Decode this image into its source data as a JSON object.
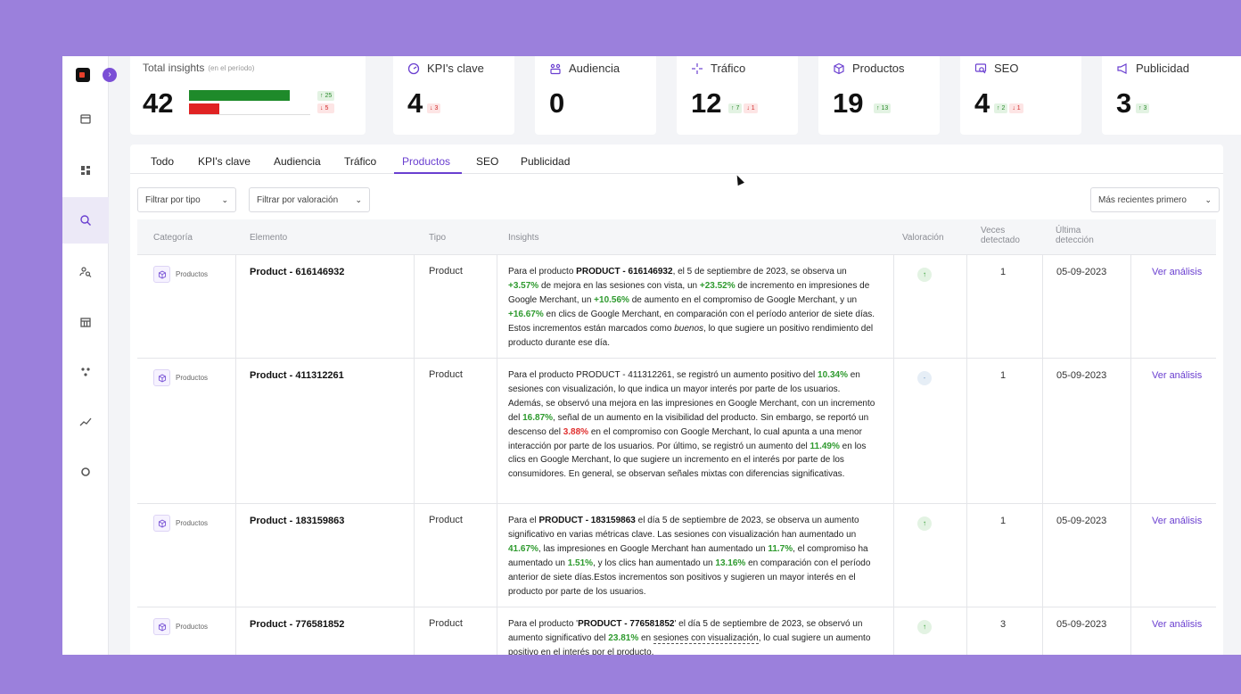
{
  "kpis": [
    {
      "title": "Total insights",
      "subtitle": "(en el período)",
      "value": "42",
      "up": "↑ 25",
      "down": "↓ 5",
      "up_fraction": 0.83,
      "down_fraction": 0.17
    },
    {
      "title": "KPI's clave",
      "value": "4",
      "down": "↓ 3",
      "icon": "gauge-icon"
    },
    {
      "title": "Audiencia",
      "value": "0",
      "icon": "audience-icon"
    },
    {
      "title": "Tráfico",
      "value": "12",
      "up": "↑ 7",
      "down": "↓ 1",
      "icon": "sparkle-icon"
    },
    {
      "title": "Productos",
      "value": "19",
      "up": "↑ 13",
      "icon": "box-icon"
    },
    {
      "title": "SEO",
      "value": "4",
      "up": "↑ 2",
      "down": "↓ 1",
      "icon": "seo-icon"
    },
    {
      "title": "Publicidad",
      "value": "3",
      "up": "↑ 3",
      "icon": "megaphone-icon"
    }
  ],
  "tabs": [
    "Todo",
    "KPI's clave",
    "Audiencia",
    "Tráfico",
    "Productos",
    "SEO",
    "Publicidad"
  ],
  "active_tab": "Productos",
  "filters": {
    "type": "Filtrar por tipo",
    "rating": "Filtrar por valoración",
    "sort": "Más recientes primero"
  },
  "columns": {
    "categoria": "Categoría",
    "elemento": "Elemento",
    "tipo": "Tipo",
    "insights": "Insights",
    "valoracion": "Valoración",
    "veces": "Veces detectado",
    "ultima": "Última detección"
  },
  "rows": [
    {
      "categoria": "Productos",
      "elemento": "Product - 616146932",
      "tipo": "Product",
      "rating": "↑",
      "veces": "1",
      "fecha": "05-09-2023",
      "link": "Ver análisis",
      "insight": [
        [
          "t",
          "Para el producto "
        ],
        [
          "b",
          "PRODUCT - 616146932"
        ],
        [
          "t",
          ", el 5 de septiembre de 2023, se observa un "
        ],
        [
          "g",
          "+3.57%"
        ],
        [
          "t",
          " de mejora en las sesiones con vista, un "
        ],
        [
          "g",
          "+23.52%"
        ],
        [
          "t",
          " de incremento en impresiones de Google Merchant, un "
        ],
        [
          "g",
          "+10.56%"
        ],
        [
          "t",
          " de aumento en el compromiso de Google Merchant, y un "
        ],
        [
          "g",
          "+16.67%"
        ],
        [
          "t",
          " en clics de Google Merchant, en comparación con el período anterior de siete días. Estos incrementos están marcados como "
        ],
        [
          "i",
          "buenos"
        ],
        [
          "t",
          ", lo que sugiere un positivo rendimiento del producto durante ese día."
        ]
      ]
    },
    {
      "categoria": "Productos",
      "elemento": "Product - 411312261",
      "tipo": "Product",
      "rating": "-",
      "veces": "1",
      "fecha": "05-09-2023",
      "link": "Ver análisis",
      "insight": [
        [
          "t",
          "Para el producto PRODUCT - 411312261, se registró un aumento positivo del "
        ],
        [
          "g",
          "10.34%"
        ],
        [
          "t",
          " en sesiones con visualización, lo que indica un mayor interés por parte de los usuarios. Además, se observó una mejora en las impresiones en Google Merchant, con un incremento del "
        ],
        [
          "g",
          "16.87%"
        ],
        [
          "t",
          ", señal de un aumento en la visibilidad del producto. Sin embargo, se reportó un descenso del "
        ],
        [
          "r",
          "3.88%"
        ],
        [
          "t",
          " en el compromiso con Google Merchant, lo cual apunta a una menor interacción por parte de los usuarios. Por último, se registró un aumento del "
        ],
        [
          "g",
          "11.49%"
        ],
        [
          "t",
          " en los clics en Google Merchant, lo que sugiere un incremento en el interés por parte de los consumidores. En general, se observan señales mixtas con diferencias significativas."
        ]
      ]
    },
    {
      "categoria": "Productos",
      "elemento": "Product - 183159863",
      "tipo": "Product",
      "rating": "↑",
      "veces": "1",
      "fecha": "05-09-2023",
      "link": "Ver análisis",
      "insight": [
        [
          "t",
          "Para el "
        ],
        [
          "b",
          "PRODUCT - 183159863"
        ],
        [
          "t",
          " el día 5 de septiembre de 2023, se observa un aumento significativo en varias métricas clave. Las sesiones con visualización han aumentado un "
        ],
        [
          "g",
          "41.67%"
        ],
        [
          "t",
          ", las impresiones en Google Merchant han aumentado un "
        ],
        [
          "g",
          "11.7%"
        ],
        [
          "t",
          ", el compromiso ha aumentado un "
        ],
        [
          "g",
          "1.51%"
        ],
        [
          "t",
          ", y los clics han aumentado un "
        ],
        [
          "g",
          "13.16%"
        ],
        [
          "t",
          " en comparación con el período anterior de siete días.Estos incrementos son positivos y sugieren un mayor interés en el producto por parte de los usuarios."
        ]
      ]
    },
    {
      "categoria": "Productos",
      "elemento": "Product - 776581852",
      "tipo": "Product",
      "rating": "↑",
      "veces": "3",
      "fecha": "05-09-2023",
      "link": "Ver análisis",
      "insight": [
        [
          "t",
          "Para el producto '"
        ],
        [
          "b",
          "PRODUCT - 776581852"
        ],
        [
          "t",
          "' el día 5 de septiembre de 2023, se observó un aumento significativo del "
        ],
        [
          "g",
          "23.81%"
        ],
        [
          "t",
          " en "
        ],
        [
          "u",
          "sesiones con visualización"
        ],
        [
          "t",
          ", lo cual sugiere un aumento positivo en el interés por el producto."
        ]
      ]
    }
  ],
  "colors": {
    "background": "#9b80dc",
    "accent": "#6a3fd0",
    "positive": "#2e9a2e",
    "negative": "#e0302f"
  }
}
